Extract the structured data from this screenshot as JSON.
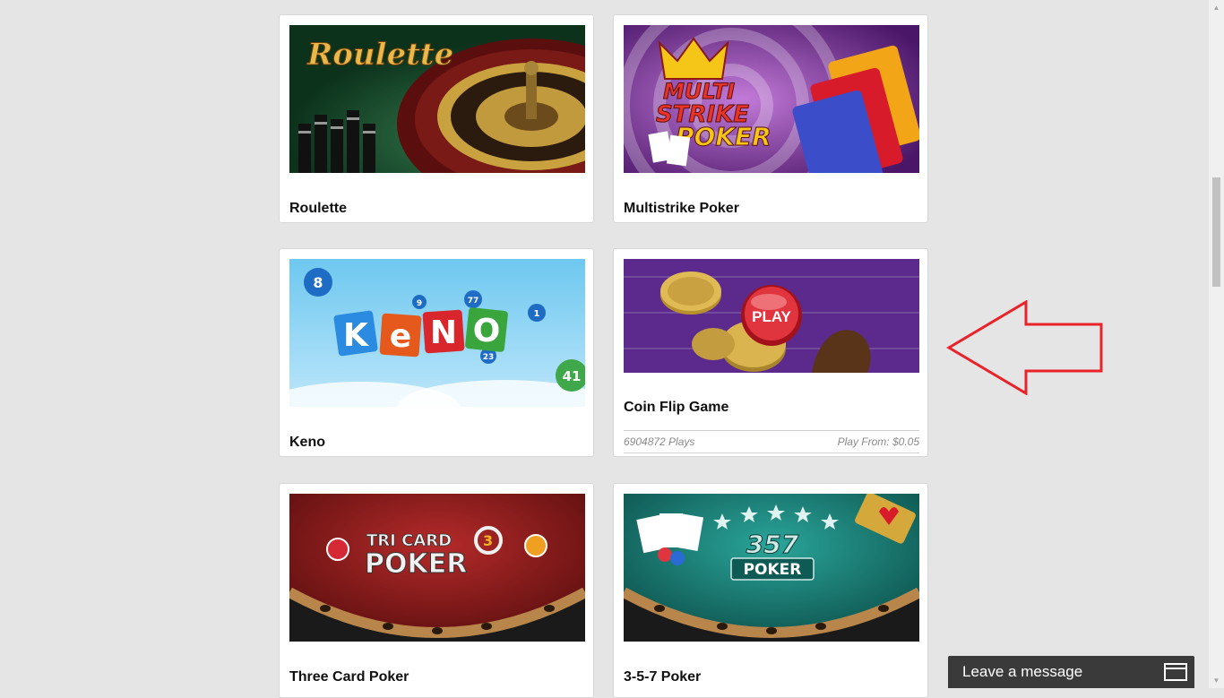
{
  "games": [
    {
      "title": "Roulette",
      "thumb_icon": "roulette-thumbnail"
    },
    {
      "title": "Multistrike Poker",
      "thumb_icon": "multistrike-poker-thumbnail"
    },
    {
      "title": "Keno",
      "thumb_icon": "keno-thumbnail"
    },
    {
      "title": "Coin Flip Game",
      "thumb_icon": "coin-flip-thumbnail",
      "plays": "6904872 Plays",
      "play_from": "Play From: $0.05",
      "play_label": "PLAY"
    },
    {
      "title": "Three Card Poker",
      "thumb_icon": "three-card-poker-thumbnail"
    },
    {
      "title": "3-5-7 Poker",
      "thumb_icon": "357-poker-thumbnail"
    }
  ],
  "chat": {
    "label": "Leave a message",
    "icon": "message-window-icon"
  },
  "annotation": {
    "arrow_color": "#e8232a"
  },
  "thumb_text": {
    "roulette": "Roulette",
    "multistrike_1": "MULTI",
    "multistrike_2": "STRIKE",
    "multistrike_3": "POKER",
    "keno": [
      "K",
      "e",
      "N",
      "O"
    ],
    "keno_balls": [
      "8",
      "9",
      "77",
      "1",
      "23",
      "41"
    ],
    "tricard_1": "TRI CARD",
    "tricard_3": "3",
    "tricard_2": "POKER",
    "p357_num": "357",
    "p357_word": "POKER"
  }
}
